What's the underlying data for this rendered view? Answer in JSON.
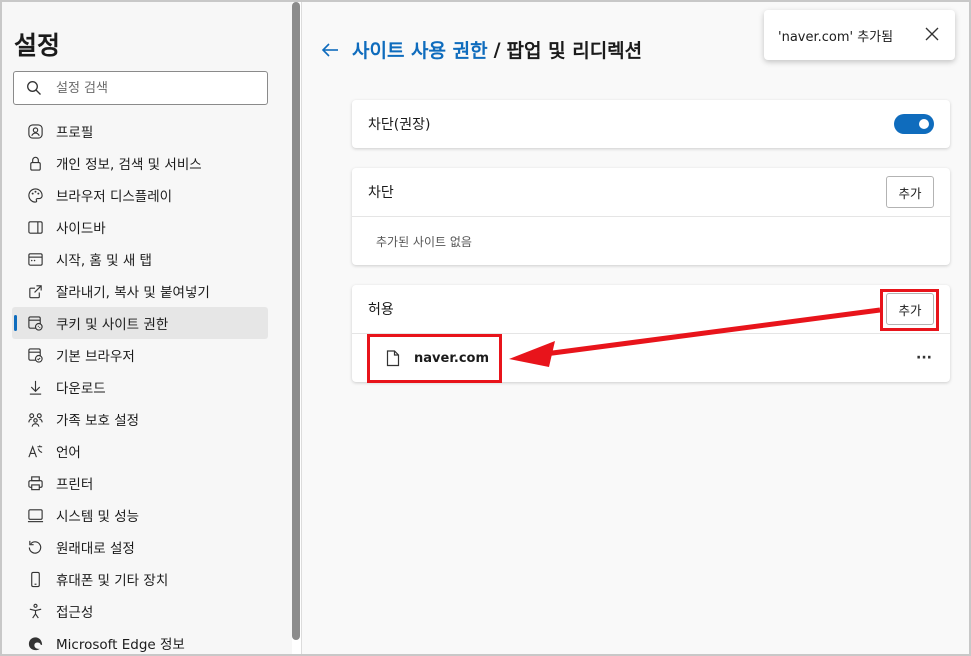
{
  "sidebar": {
    "title": "설정",
    "search_placeholder": "설정 검색",
    "items": [
      {
        "label": "프로필",
        "icon": "profile-icon"
      },
      {
        "label": "개인 정보, 검색 및 서비스",
        "icon": "lock-icon"
      },
      {
        "label": "브라우저 디스플레이",
        "icon": "palette-icon"
      },
      {
        "label": "사이드바",
        "icon": "sidebar-icon"
      },
      {
        "label": "시작, 홈 및 새 탭",
        "icon": "home-tab-icon"
      },
      {
        "label": "잘라내기, 복사 및 붙여넣기",
        "icon": "share-icon"
      },
      {
        "label": "쿠키 및 사이트 권한",
        "icon": "cookie-site-icon",
        "active": true
      },
      {
        "label": "기본 브라우저",
        "icon": "default-browser-icon"
      },
      {
        "label": "다운로드",
        "icon": "download-icon"
      },
      {
        "label": "가족 보호 설정",
        "icon": "family-icon"
      },
      {
        "label": "언어",
        "icon": "language-icon"
      },
      {
        "label": "프린터",
        "icon": "printer-icon"
      },
      {
        "label": "시스템 및 성능",
        "icon": "system-icon"
      },
      {
        "label": "원래대로 설정",
        "icon": "reset-icon"
      },
      {
        "label": "휴대폰 및 기타 장치",
        "icon": "phone-icon"
      },
      {
        "label": "접근성",
        "icon": "accessibility-icon"
      },
      {
        "label": "Microsoft Edge 정보",
        "icon": "edge-icon"
      }
    ]
  },
  "header": {
    "parent": "사이트 사용 권한",
    "separator": "/",
    "current": "팝업 및 리디렉션"
  },
  "toast": {
    "message": "'naver.com' 추가됨"
  },
  "blocked_recommended": {
    "label": "차단(권장)",
    "enabled": true
  },
  "block_section": {
    "title": "차단",
    "add_label": "추가",
    "empty_text": "추가된 사이트 없음"
  },
  "allow_section": {
    "title": "허용",
    "add_label": "추가",
    "sites": [
      {
        "name": "naver.com",
        "more": "···"
      }
    ]
  },
  "colors": {
    "accent": "#0f6cbd",
    "annotation": "#e8141b"
  }
}
